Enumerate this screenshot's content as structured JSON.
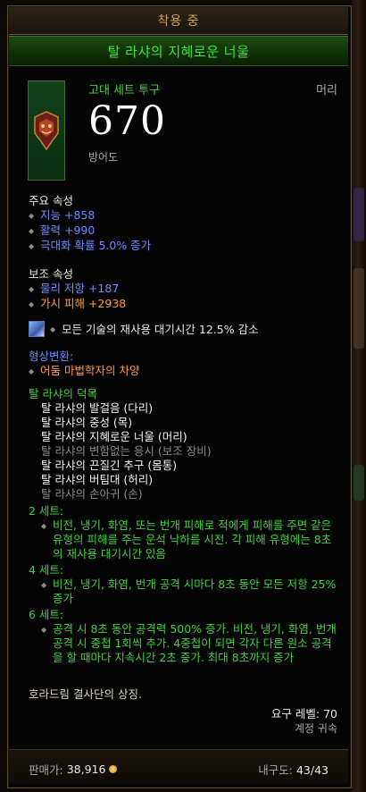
{
  "header": {
    "equipped_label": "착용 중"
  },
  "item": {
    "name": "탈 라샤의 지혜로운 너울",
    "type": "고대 세트 투구",
    "slot": "머리",
    "armor_value": "670",
    "armor_label": "방어도",
    "icon": "helm-icon"
  },
  "primary": {
    "title": "주요 속성",
    "stats": [
      "지능 +858",
      "활력 +990",
      "극대화 확률 5.0% 증가"
    ]
  },
  "secondary": {
    "title": "보조 속성",
    "stats": [
      "물리 저항 +187",
      "가시 피해 +2938"
    ]
  },
  "socket": {
    "text": "모든 기술의 재사용 대기시간 12.5% 감소",
    "icon": "gem-icon"
  },
  "transmog": {
    "title": "형상변환:",
    "value": "어둠 마법학자의 차양"
  },
  "set": {
    "name": "탈 라샤의 덕목",
    "items": [
      {
        "label": "탈 라샤의 발걸음 (다리)",
        "owned": true
      },
      {
        "label": "탈 라샤의 중성 (목)",
        "owned": true
      },
      {
        "label": "탈 라샤의 지혜로운 너울 (머리)",
        "owned": true
      },
      {
        "label": "탈 라샤의 변함없는 응시 (보조 장비)",
        "owned": false
      },
      {
        "label": "탈 라샤의 끈질긴 추구 (몸통)",
        "owned": true
      },
      {
        "label": "탈 라샤의 버팀대 (허리)",
        "owned": true
      },
      {
        "label": "탈 라샤의 손아귀 (손)",
        "owned": false
      }
    ],
    "bonuses": [
      {
        "title": "2 세트:",
        "text": "비전, 냉기, 화염, 또는 번개 피해로 적에게 피해를 주면 같은 유형의 피해를 주는 운석 낙하를 시전. 각 피해 유형에는 8초의 재사용 대기시간 있음"
      },
      {
        "title": "4 세트:",
        "text": "비전, 냉기, 화염, 번개 공격 시마다 8초 동안 모든 저항 25% 증가"
      },
      {
        "title": "6 세트:",
        "text": "공격 시 8초 동안 공격력 500% 증가. 비전, 냉기, 화염, 번개 공격 시 중첩 1회씩 추가. 4중첩이 되면 각자 다른 원소 공격을 할 때마다 지속시간 2초 증가. 최대 8초까지 증가"
      }
    ]
  },
  "flavor": "호라드림 결사단의 상징.",
  "requirement": "요구 레벨: 70",
  "bound": "계정 귀속",
  "footer": {
    "sell_label": "판매가:",
    "sell_value": "38,916",
    "durability_label": "내구도:",
    "durability_value": "43/43"
  },
  "colors": {
    "set_green": "#3ed33a",
    "magic_blue": "#6b8bff",
    "legendary_orange": "#ff9a3c",
    "gold_header": "#c9a35c"
  }
}
